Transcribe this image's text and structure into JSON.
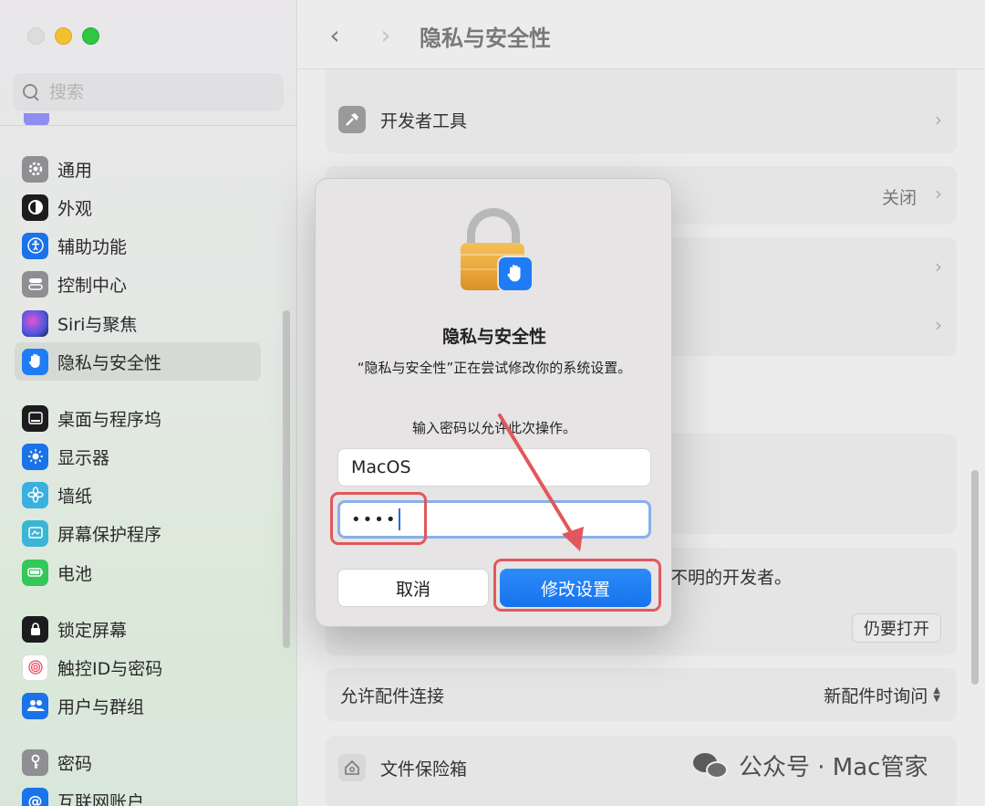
{
  "window": {
    "title": "隐私与安全性"
  },
  "search": {
    "placeholder": "搜索"
  },
  "sidebar": {
    "items": [
      {
        "label": "通用",
        "icon": "gear-icon"
      },
      {
        "label": "外观",
        "icon": "appearance-icon"
      },
      {
        "label": "辅助功能",
        "icon": "accessibility-icon"
      },
      {
        "label": "控制中心",
        "icon": "control-center-icon"
      },
      {
        "label": "Siri与聚焦",
        "icon": "siri-icon"
      },
      {
        "label": "隐私与安全性",
        "icon": "hand-icon",
        "selected": true
      },
      {
        "label": "桌面与程序坞",
        "icon": "dock-icon"
      },
      {
        "label": "显示器",
        "icon": "sun-icon"
      },
      {
        "label": "墙纸",
        "icon": "flower-icon"
      },
      {
        "label": "屏幕保护程序",
        "icon": "screensaver-icon"
      },
      {
        "label": "电池",
        "icon": "battery-icon"
      },
      {
        "label": "锁定屏幕",
        "icon": "lock-icon"
      },
      {
        "label": "触控ID与密码",
        "icon": "fingerprint-icon"
      },
      {
        "label": "用户与群组",
        "icon": "users-icon"
      },
      {
        "label": "密码",
        "icon": "key-icon"
      },
      {
        "label": "互联网账户",
        "icon": "at-icon"
      }
    ]
  },
  "main": {
    "developer_tools": "开发者工具",
    "row_off_value": "关闭",
    "blocked_msg_tail": "不明的开发者。",
    "open_anyway": "仍要打开",
    "accessory_label": "允许配件连接",
    "accessory_value": "新配件时询问",
    "filevault": "文件保险箱"
  },
  "dialog": {
    "title": "隐私与安全性",
    "message": "“隐私与安全性”正在尝试修改你的系统设置。",
    "prompt": "输入密码以允许此次操作。",
    "username": "MacOS",
    "password_mask": "••••",
    "cancel_label": "取消",
    "confirm_label": "修改设置"
  },
  "watermark": {
    "text": "公众号 · Mac管家"
  },
  "colors": {
    "accent": "#1673ee",
    "annotation": "#e2575b"
  }
}
